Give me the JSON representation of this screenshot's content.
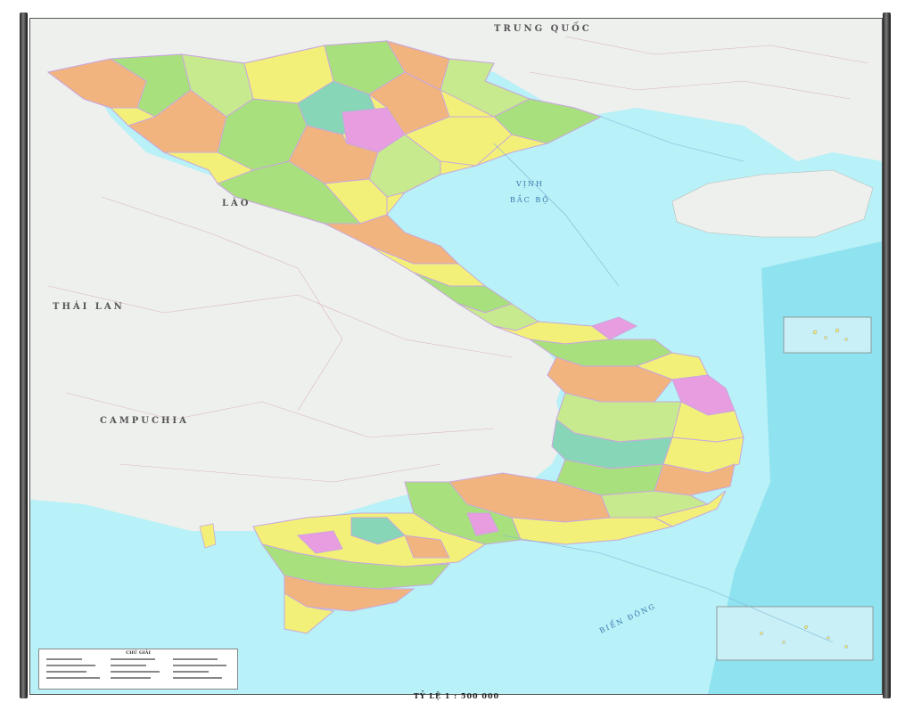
{
  "map": {
    "labels": {
      "china": "TRUNG QUỐC",
      "laos": "LÀO",
      "thailand": "THÁI LAN",
      "cambodia": "CAMPUCHIA",
      "gulf_tonkin_1": "VỊNH",
      "gulf_tonkin_2": "BẮC BỘ",
      "east_sea": "BIỂN ĐÔNG"
    },
    "scale_text": "TỶ LỆ 1 : 500 000",
    "legend_title": "CHÚ GIẢI"
  },
  "colors": {
    "sea": "#b8f1f7",
    "land_neighbor": "#eef0ee",
    "border_vn": "#c9a7dc",
    "province_yellow": "#f3f07a",
    "province_green": "#a9e07e",
    "province_orange": "#f2b47f",
    "province_pink": "#e89de0",
    "province_lightgreen": "#c8ea8e",
    "province_teal": "#88d6b8"
  }
}
